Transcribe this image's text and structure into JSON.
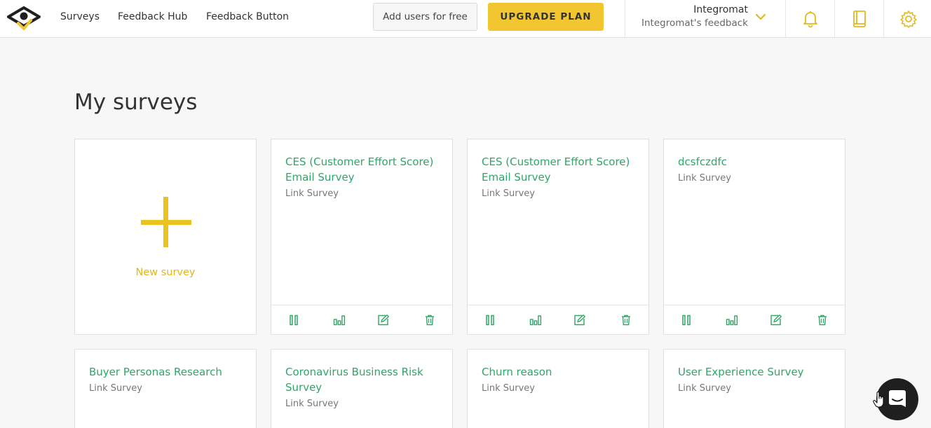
{
  "colors": {
    "accent_yellow": "#f2c631",
    "link_green": "#2fa667",
    "background": "#f7f7f7"
  },
  "header": {
    "logo_icon": "eye-logo-icon",
    "nav": [
      "Surveys",
      "Feedback Hub",
      "Feedback Button"
    ],
    "add_users_label": "Add users for free",
    "upgrade_label": "UPGRADE PLAN",
    "account": {
      "name": "Integromat",
      "workspace": "Integromat's feedback"
    },
    "icons": [
      "bell-icon",
      "book-icon",
      "gear-icon"
    ]
  },
  "main": {
    "title": "My surveys",
    "new_survey_label": "New survey",
    "surveys": [
      {
        "title": "CES (Customer Effort Score) Email Survey",
        "type": "Link Survey"
      },
      {
        "title": "CES (Customer Effort Score) Email Survey",
        "type": "Link Survey"
      },
      {
        "title": "dcsfczdfc",
        "type": "Link Survey"
      },
      {
        "title": "Buyer Personas Research",
        "type": "Link Survey"
      },
      {
        "title": "Coronavirus Business Risk Survey",
        "type": "Link Survey"
      },
      {
        "title": "Churn reason",
        "type": "Link Survey"
      },
      {
        "title": "User Experience Survey",
        "type": "Link Survey"
      }
    ],
    "card_actions": [
      "pause-icon",
      "stats-icon",
      "edit-icon",
      "trash-icon"
    ]
  },
  "chat_widget_icon": "chat-icon"
}
